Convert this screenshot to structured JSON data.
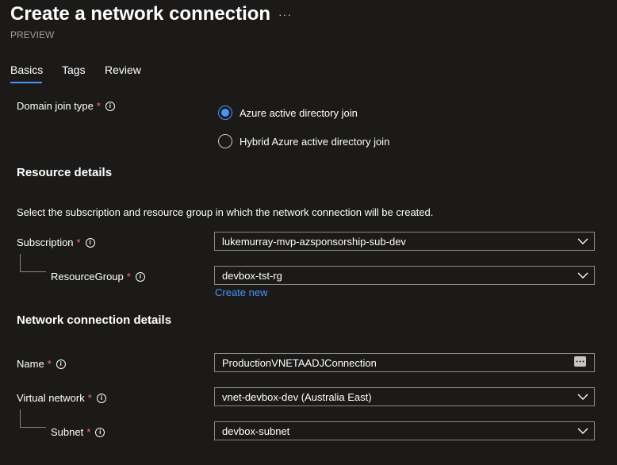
{
  "header": {
    "title": "Create a network connection",
    "more_label": "···",
    "subtitle": "PREVIEW"
  },
  "tabs": [
    {
      "label": "Basics",
      "active": true
    },
    {
      "label": "Tags",
      "active": false
    },
    {
      "label": "Review",
      "active": false
    }
  ],
  "form": {
    "domain_join": {
      "label": "Domain join type",
      "required_mark": "*",
      "options": [
        {
          "label": "Azure active directory join",
          "selected": true
        },
        {
          "label": "Hybrid Azure active directory join",
          "selected": false
        }
      ]
    },
    "resource_details": {
      "heading": "Resource details",
      "description": "Select the subscription and resource group in which the network connection will be created.",
      "subscription": {
        "label": "Subscription",
        "value": "lukemurray-mvp-azsponsorship-sub-dev"
      },
      "resource_group": {
        "label": "ResourceGroup",
        "value": "devbox-tst-rg",
        "create_new": "Create new"
      }
    },
    "network_details": {
      "heading": "Network connection details",
      "name": {
        "label": "Name",
        "value": "ProductionVNETAADJConnection"
      },
      "virtual_network": {
        "label": "Virtual network",
        "value": "vnet-devbox-dev (Australia East)"
      },
      "subnet": {
        "label": "Subnet",
        "value": "devbox-subnet"
      }
    }
  },
  "theme": {
    "background": "#1b1a19",
    "accent": "#4894fe",
    "required": "#f1707b",
    "border": "#8a8886"
  },
  "icons": {
    "info": "info-icon",
    "chevron": "chevron-down-icon",
    "more": "more-icon"
  }
}
